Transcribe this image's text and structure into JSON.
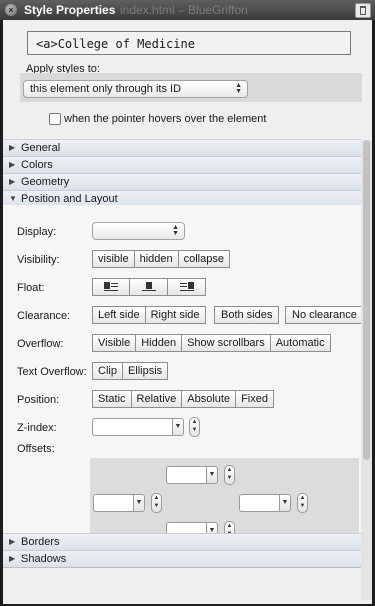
{
  "window": {
    "title": "Style Properties",
    "background_title": "index.html – BlueGriffon"
  },
  "element_field": {
    "tag": "<a>",
    "text": "College of Medicine"
  },
  "apply": {
    "label": "Apply styles to:",
    "selected": "this element only through its ID",
    "hover_checked": false,
    "hover_label": "when the pointer hovers over the element"
  },
  "sections": {
    "general": "General",
    "colors": "Colors",
    "geometry": "Geometry",
    "position": "Position and Layout",
    "borders": "Borders",
    "shadows": "Shadows"
  },
  "position_layout": {
    "display_label": "Display:",
    "display_value": "",
    "visibility_label": "Visibility:",
    "visibility_options": [
      "visible",
      "hidden",
      "collapse"
    ],
    "float_label": "Float:",
    "clearance_label": "Clearance:",
    "clearance_options": [
      "Left side",
      "Right side",
      "Both sides",
      "No clearance"
    ],
    "overflow_label": "Overflow:",
    "overflow_options": [
      "Visible",
      "Hidden",
      "Show scrollbars",
      "Automatic"
    ],
    "text_overflow_label": "Text Overflow:",
    "text_overflow_options": [
      "Clip",
      "Ellipsis"
    ],
    "position_label": "Position:",
    "position_options": [
      "Static",
      "Relative",
      "Absolute",
      "Fixed"
    ],
    "zindex_label": "Z-index:",
    "offsets_label": "Offsets:"
  },
  "icons": {
    "close": "close-icon",
    "pin": "pin-icon",
    "float_left": "float-left-icon",
    "float_none": "float-none-icon",
    "float_right": "float-right-icon"
  }
}
